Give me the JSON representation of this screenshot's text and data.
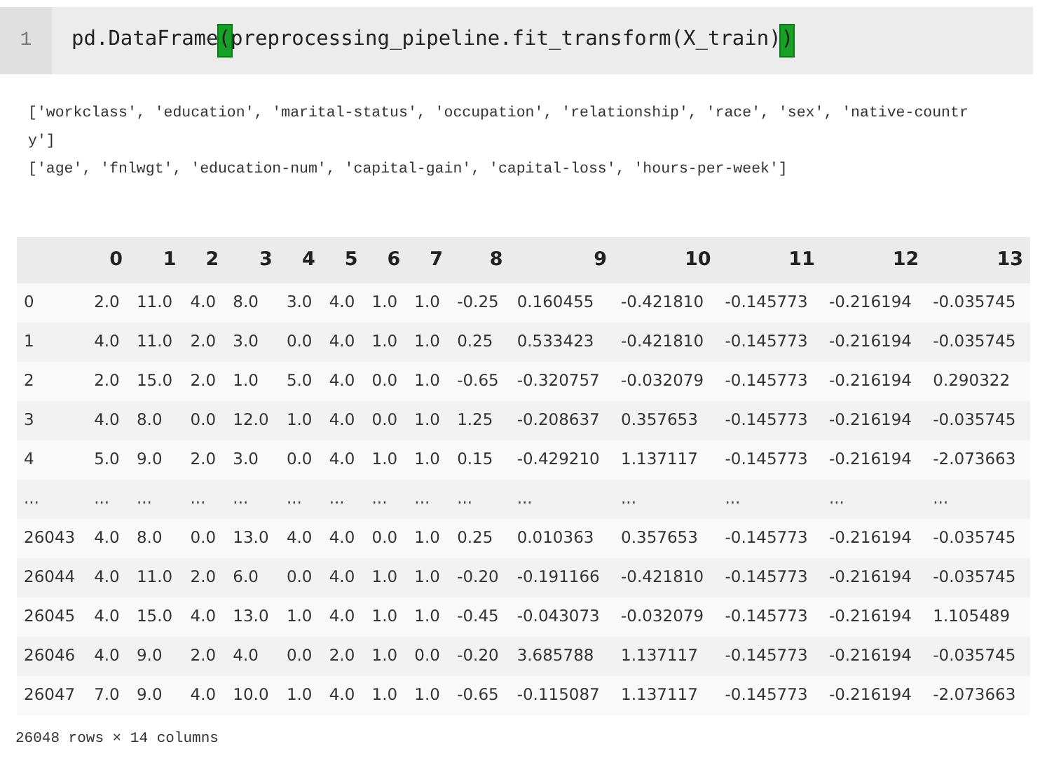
{
  "code_cell": {
    "line_number": "1",
    "tokens": [
      {
        "text": "pd.DataFrame",
        "kind": "plain"
      },
      {
        "text": "(",
        "kind": "matched-bracket"
      },
      {
        "text": "preprocessing_pipeline.fit_transform(X_train)",
        "kind": "plain"
      },
      {
        "text": ")",
        "kind": "matched-bracket"
      }
    ]
  },
  "stdout_lines": [
    "['workclass', 'education', 'marital-status', 'occupation', 'relationship', 'race', 'sex', 'native-country']",
    "['age', 'fnlwgt', 'education-num', 'capital-gain', 'capital-loss', 'hours-per-week']"
  ],
  "table": {
    "columns": [
      "",
      "0",
      "1",
      "2",
      "3",
      "4",
      "5",
      "6",
      "7",
      "8",
      "9",
      "10",
      "11",
      "12",
      "13"
    ],
    "rows": [
      [
        "0",
        "2.0",
        "11.0",
        "4.0",
        "8.0",
        "3.0",
        "4.0",
        "1.0",
        "1.0",
        "-0.25",
        "0.160455",
        "-0.421810",
        "-0.145773",
        "-0.216194",
        "-0.035745"
      ],
      [
        "1",
        "4.0",
        "11.0",
        "2.0",
        "3.0",
        "0.0",
        "4.0",
        "1.0",
        "1.0",
        "0.25",
        "0.533423",
        "-0.421810",
        "-0.145773",
        "-0.216194",
        "-0.035745"
      ],
      [
        "2",
        "2.0",
        "15.0",
        "2.0",
        "1.0",
        "5.0",
        "4.0",
        "0.0",
        "1.0",
        "-0.65",
        "-0.320757",
        "-0.032079",
        "-0.145773",
        "-0.216194",
        "0.290322"
      ],
      [
        "3",
        "4.0",
        "8.0",
        "0.0",
        "12.0",
        "1.0",
        "4.0",
        "0.0",
        "1.0",
        "1.25",
        "-0.208637",
        "0.357653",
        "-0.145773",
        "-0.216194",
        "-0.035745"
      ],
      [
        "4",
        "5.0",
        "9.0",
        "2.0",
        "3.0",
        "0.0",
        "4.0",
        "1.0",
        "1.0",
        "0.15",
        "-0.429210",
        "1.137117",
        "-0.145773",
        "-0.216194",
        "-2.073663"
      ],
      [
        "...",
        "...",
        "...",
        "...",
        "...",
        "...",
        "...",
        "...",
        "...",
        "...",
        "...",
        "...",
        "...",
        "...",
        "..."
      ],
      [
        "26043",
        "4.0",
        "8.0",
        "0.0",
        "13.0",
        "4.0",
        "4.0",
        "0.0",
        "1.0",
        "0.25",
        "0.010363",
        "0.357653",
        "-0.145773",
        "-0.216194",
        "-0.035745"
      ],
      [
        "26044",
        "4.0",
        "11.0",
        "2.0",
        "6.0",
        "0.0",
        "4.0",
        "1.0",
        "1.0",
        "-0.20",
        "-0.191166",
        "-0.421810",
        "-0.145773",
        "-0.216194",
        "-0.035745"
      ],
      [
        "26045",
        "4.0",
        "15.0",
        "4.0",
        "13.0",
        "1.0",
        "4.0",
        "1.0",
        "1.0",
        "-0.45",
        "-0.043073",
        "-0.032079",
        "-0.145773",
        "-0.216194",
        "1.105489"
      ],
      [
        "26046",
        "4.0",
        "9.0",
        "2.0",
        "4.0",
        "0.0",
        "2.0",
        "1.0",
        "0.0",
        "-0.20",
        "3.685788",
        "1.137117",
        "-0.145773",
        "-0.216194",
        "-0.035745"
      ],
      [
        "26047",
        "7.0",
        "9.0",
        "4.0",
        "10.0",
        "1.0",
        "4.0",
        "1.0",
        "1.0",
        "-0.65",
        "-0.115087",
        "1.137117",
        "-0.145773",
        "-0.216194",
        "-2.073663"
      ]
    ]
  },
  "footer": "26048 rows × 14 columns"
}
